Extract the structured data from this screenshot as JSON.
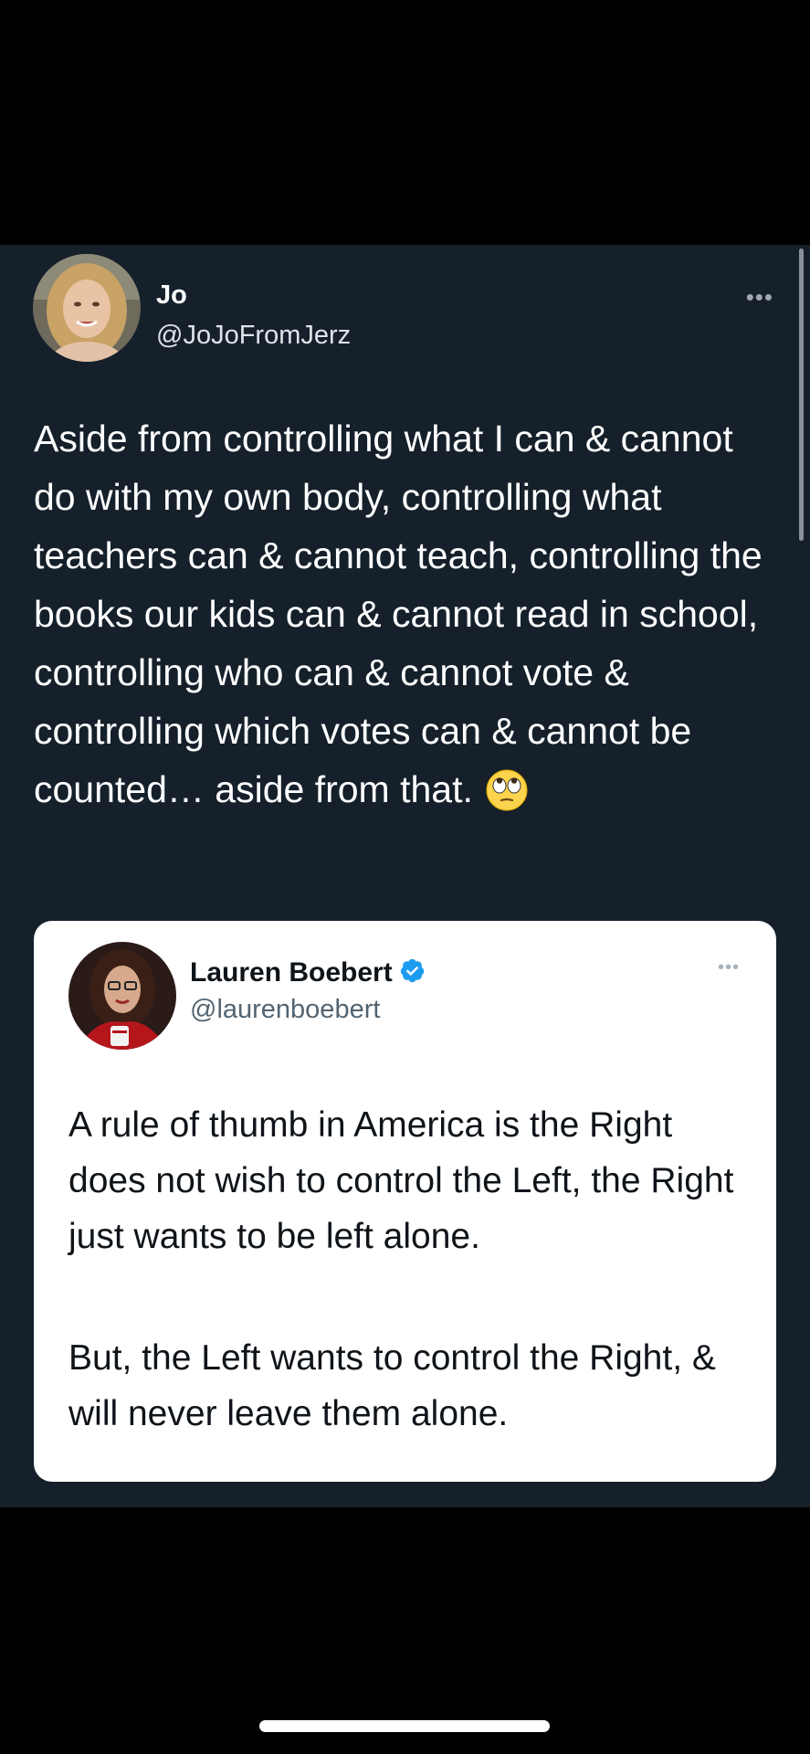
{
  "tweet": {
    "author_name": "Jo",
    "author_handle": "@JoJoFromJerz",
    "more_icon": "more-horizontal-icon",
    "text": "Aside from controlling what I can & cannot do with my own body, controlling what teachers can & cannot teach, controlling the books our kids can & cannot read in school, controlling who can & cannot vote & controlling which votes can & cannot be counted… aside from that.",
    "emoji": "face-with-rolling-eyes-emoji"
  },
  "quoted_tweet": {
    "author_name": "Lauren Boebert",
    "author_handle": "@laurenboebert",
    "verified_icon": "verified-badge-icon",
    "paragraph_1": "A rule of thumb in America is the Right does not wish to control the Left, the Right just wants to be left alone.",
    "paragraph_2": "But, the Left wants to control the Right, & will never leave them alone."
  },
  "colors": {
    "background": "#15202b",
    "quote_background": "#ffffff",
    "verified_blue": "#1d9bf0"
  }
}
